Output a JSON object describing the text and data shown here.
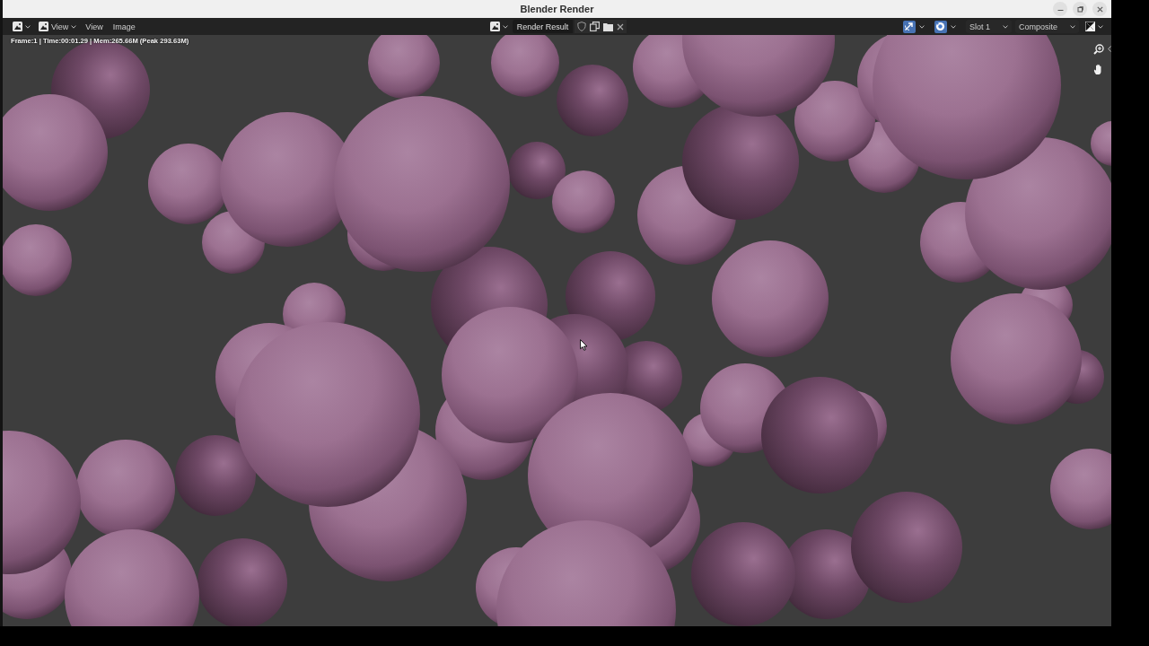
{
  "window": {
    "title": "Blender Render"
  },
  "header": {
    "mode_dropdown": "View",
    "menus": [
      "View",
      "Image"
    ],
    "image_name": "Render Result",
    "toggles": [
      {
        "kind": "gizmo",
        "on": true
      },
      {
        "kind": "overlay",
        "on": true
      }
    ],
    "slot": "Slot 1",
    "layer": "Composite"
  },
  "render": {
    "info": "Frame:1 | Time:00:01.29 | Mem:265.66M (Peak 293.63M)"
  }
}
